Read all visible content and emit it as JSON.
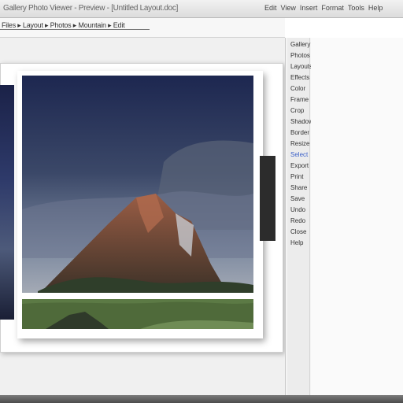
{
  "window": {
    "title": "Gallery Photo Viewer - Preview - [Untitled Layout.doc]"
  },
  "menu": {
    "items": [
      "Edit",
      "View",
      "Insert",
      "Format",
      "Tools",
      "Help"
    ]
  },
  "toolbar": {
    "text": "Files ▸ Layout ▸ Photos ▸ Mountain ▸ Edit"
  },
  "side_panel": {
    "items": [
      {
        "label": "Gallery"
      },
      {
        "label": "Photos"
      },
      {
        "label": "Layouts"
      },
      {
        "label": "Effects"
      },
      {
        "label": "Color"
      },
      {
        "label": "Frame"
      },
      {
        "label": "Crop"
      },
      {
        "label": "Shadow"
      },
      {
        "label": "Border"
      },
      {
        "label": "Resize"
      },
      {
        "label": "Select",
        "active": true
      },
      {
        "label": "Export"
      },
      {
        "label": "Print"
      },
      {
        "label": "Share"
      },
      {
        "label": "Save"
      },
      {
        "label": "Undo"
      },
      {
        "label": "Redo"
      },
      {
        "label": "Close"
      },
      {
        "label": "Help"
      }
    ]
  },
  "colors": {
    "sky_top": "#1f2a55",
    "sky_mid": "#4a5878",
    "mountain": "#7a4a3a",
    "grass": "#4f6a3a",
    "accent": "#3a5fc8"
  },
  "icons": [
    "menu-icon",
    "folder-icon",
    "image-icon"
  ]
}
